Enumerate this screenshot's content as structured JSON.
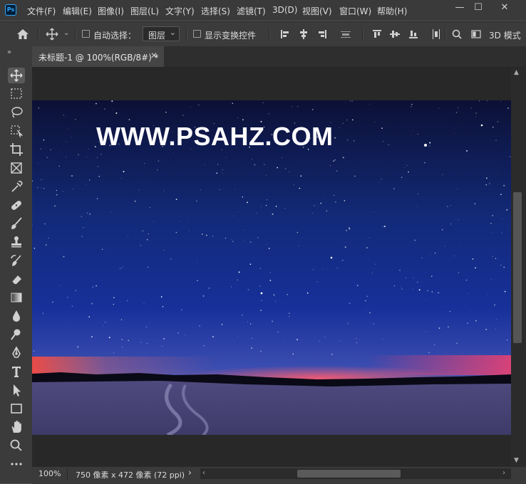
{
  "app": {
    "logo_text": "Ps"
  },
  "menu": [
    {
      "id": "file",
      "label": "文件(F)"
    },
    {
      "id": "edit",
      "label": "编辑(E)"
    },
    {
      "id": "image",
      "label": "图像(I)"
    },
    {
      "id": "layer",
      "label": "图层(L)"
    },
    {
      "id": "type",
      "label": "文字(Y)"
    },
    {
      "id": "select",
      "label": "选择(S)"
    },
    {
      "id": "filter",
      "label": "滤镜(T)"
    },
    {
      "id": "3d",
      "label": "3D(D)"
    },
    {
      "id": "view",
      "label": "视图(V)"
    },
    {
      "id": "window",
      "label": "窗口(W)"
    },
    {
      "id": "help",
      "label": "帮助(H)"
    }
  ],
  "window_controls": {
    "minimize": "—",
    "maximize": "☐",
    "close": "✕"
  },
  "options_bar": {
    "auto_select_label": "自动选择：",
    "auto_select_checked": false,
    "layer_select_value": "图层",
    "show_transform_label": "显示变换控件",
    "show_transform_checked": false,
    "3d_mode_label": "3D 模式"
  },
  "document_tab": {
    "title": "未标题-1 @ 100%(RGB/8#) *",
    "close": "✕"
  },
  "canvas_image": {
    "watermark_text": "WWW.PSAHZ.COM",
    "sky_top_color": "#0c1035",
    "sky_mid_color": "#17309a",
    "horizon_glow_color": "#ff5a6e",
    "snow_color": "#3e3a68"
  },
  "status": {
    "zoom": "100%",
    "doc_info": "750 像素 x 472 像素 (72 ppi)",
    "arrow": "›"
  },
  "tools": [
    {
      "name": "move-tool"
    },
    {
      "name": "rectangular-marquee-tool"
    },
    {
      "name": "lasso-tool"
    },
    {
      "name": "object-selection-tool"
    },
    {
      "name": "crop-tool"
    },
    {
      "name": "frame-tool"
    },
    {
      "name": "eyedropper-tool"
    },
    {
      "name": "healing-brush-tool"
    },
    {
      "name": "brush-tool"
    },
    {
      "name": "clone-stamp-tool"
    },
    {
      "name": "history-brush-tool"
    },
    {
      "name": "eraser-tool"
    },
    {
      "name": "gradient-tool"
    },
    {
      "name": "blur-tool"
    },
    {
      "name": "dodge-tool"
    },
    {
      "name": "pen-tool"
    },
    {
      "name": "type-tool"
    },
    {
      "name": "path-selection-tool"
    },
    {
      "name": "rectangle-tool"
    },
    {
      "name": "hand-tool"
    },
    {
      "name": "zoom-tool"
    },
    {
      "name": "more-tools"
    }
  ]
}
